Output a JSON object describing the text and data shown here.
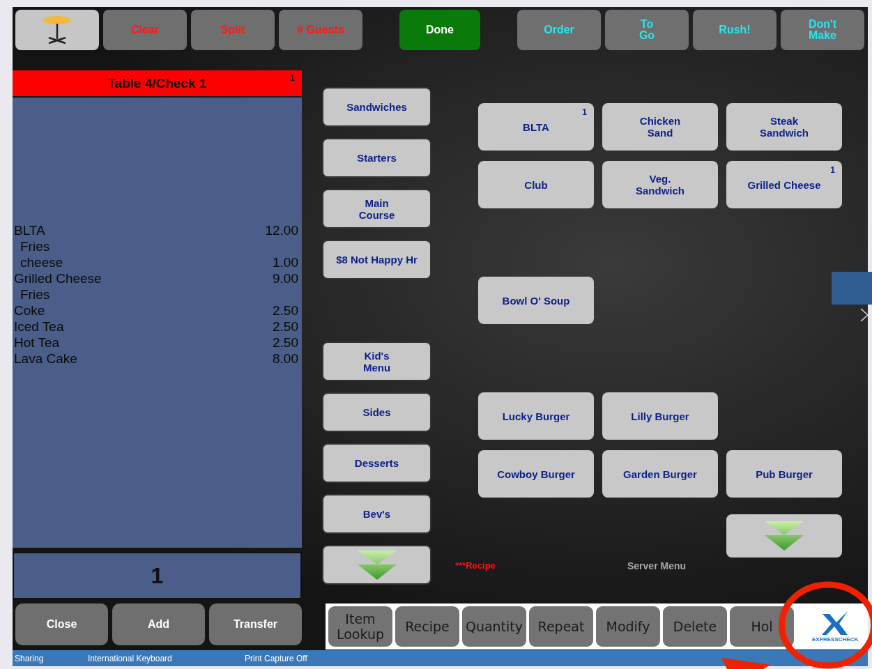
{
  "top_buttons": [
    {
      "kind": "table"
    },
    {
      "kind": "warning",
      "label": "Clear"
    },
    {
      "kind": "warning",
      "label": "Split"
    },
    {
      "kind": "warning",
      "label": "# Guests"
    },
    {
      "kind": "primary",
      "label": "Done"
    },
    {
      "kind": "option",
      "label": "Order"
    },
    {
      "kind": "option",
      "label": "To\nGo"
    },
    {
      "kind": "option",
      "label": "Rush!"
    },
    {
      "kind": "option",
      "label": "Don't\nMake"
    }
  ],
  "check": {
    "title": "Table 4/Check 1",
    "badge": "1",
    "items": [
      {
        "name": "BLTA",
        "price": "12.00",
        "children": [
          {
            "name": "Fries"
          },
          {
            "name": "cheese",
            "price": "1.00"
          }
        ]
      },
      {
        "name": "Grilled Cheese",
        "price": "9.00",
        "children": [
          {
            "name": "Fries"
          }
        ]
      },
      {
        "name": "Coke",
        "price": "2.50"
      },
      {
        "name": "Iced Tea",
        "price": "2.50"
      },
      {
        "name": "Hot Tea",
        "price": "2.50"
      },
      {
        "name": "Lava Cake",
        "price": "8.00"
      }
    ],
    "quantity": "1",
    "buttons": [
      "Close",
      "Add",
      "Transfer"
    ]
  },
  "categories": [
    {
      "kind": "label",
      "label": "Sandwiches"
    },
    {
      "kind": "label",
      "label": "Starters"
    },
    {
      "kind": "label",
      "label": "Main\nCourse"
    },
    {
      "kind": "label",
      "label": "$8 Not Happy Hr"
    },
    {
      "kind": "label",
      "label": "Kid's\nMenu"
    },
    {
      "kind": "label",
      "label": "Sides"
    },
    {
      "kind": "label",
      "label": "Desserts"
    },
    {
      "kind": "label",
      "label": "Bev's"
    },
    {
      "kind": "scroll"
    }
  ],
  "menu_items": [
    {
      "kind": "label",
      "label": "BLTA",
      "badge": "1"
    },
    {
      "kind": "label",
      "label": "Chicken\nSand"
    },
    {
      "kind": "label",
      "label": "Steak\nSandwich"
    },
    {
      "kind": "label",
      "label": "Club"
    },
    {
      "kind": "label",
      "label": "Veg.\nSandwich"
    },
    {
      "kind": "label",
      "label": "Grilled Cheese",
      "badge": "1"
    },
    {
      "kind": "label",
      "label": "Bowl O' Soup"
    },
    {
      "kind": "label",
      "label": "Lucky Burger"
    },
    {
      "kind": "label",
      "label": "Lilly Burger"
    },
    {
      "kind": "label",
      "label": "Cowboy Burger"
    },
    {
      "kind": "label",
      "label": "Garden Burger"
    },
    {
      "kind": "label",
      "label": "Pub Burger"
    },
    {
      "kind": "scroll"
    }
  ],
  "recipe_label": "***Recipe",
  "server_menu_label": "Server Menu",
  "toolbar": {
    "buttons": [
      "Item\nLookup",
      "Recipe",
      "Quantity",
      "Repeat",
      "Modify",
      "Delete",
      "Hol"
    ],
    "logo_text": "EXPRESSCHECK"
  },
  "status_bar": [
    "Sharing",
    "International Keyboard",
    "Print Capture Off"
  ]
}
